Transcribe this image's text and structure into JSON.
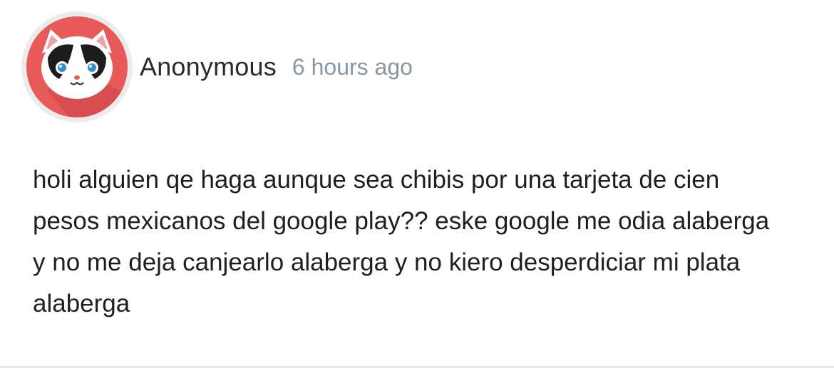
{
  "post": {
    "author": {
      "name": "Anonymous",
      "avatar_icon": "cat-face-icon",
      "avatar_bg": "#e85a5a"
    },
    "time_ago": "6 hours ago",
    "body_lines": [
      "holi alguien qe haga aunque sea chibis por una tarjeta de cien",
      "pesos mexicanos del google play?? eske google me odia alaberga",
      "y no me deja canjearlo alaberga y no kiero desperdiciar mi plata",
      "alaberga"
    ]
  }
}
